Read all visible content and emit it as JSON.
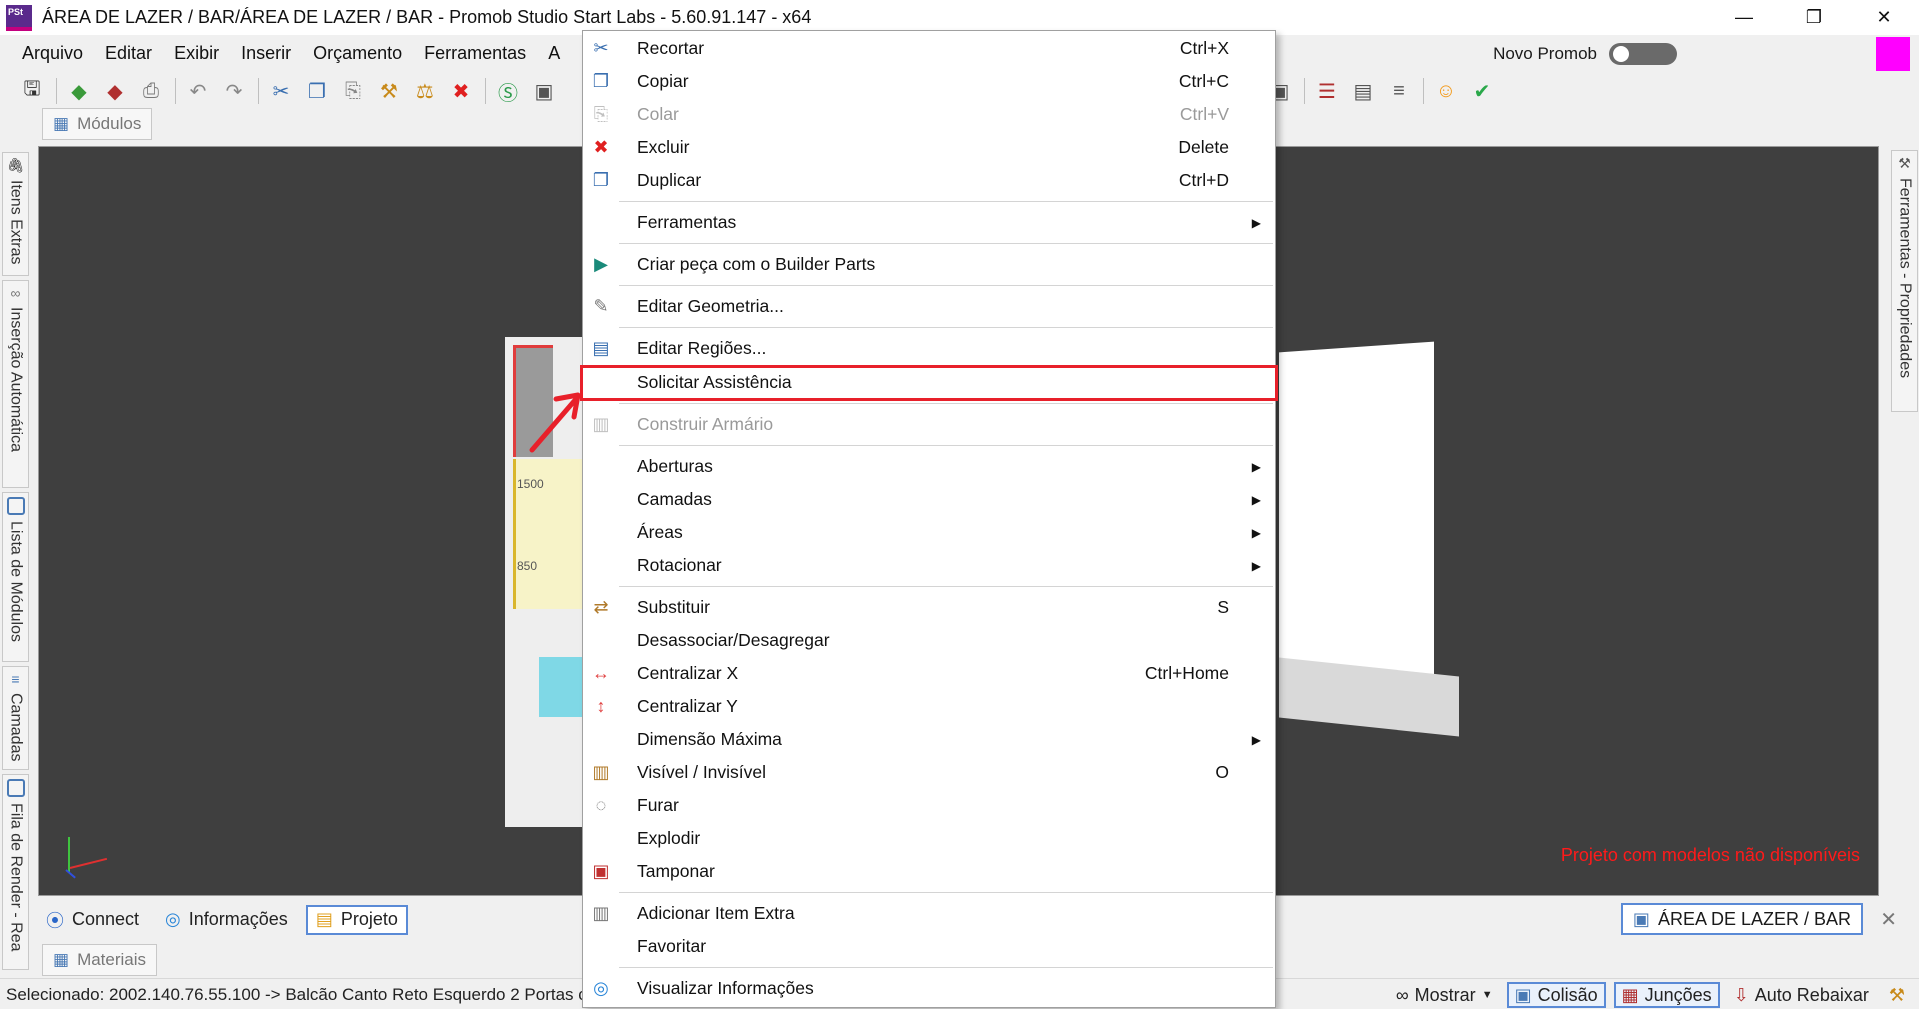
{
  "window": {
    "title": "ÁREA DE LAZER / BAR/ÁREA DE LAZER / BAR - Promob Studio Start Labs - 5.60.91.147 - x64",
    "logo_text": "PSt",
    "minimize": "—",
    "restore": "❐",
    "close": "✕"
  },
  "menubar": {
    "items": [
      "Arquivo",
      "Editar",
      "Exibir",
      "Inserir",
      "Orçamento",
      "Ferramentas",
      "A"
    ],
    "novo_promob": "Novo Promob"
  },
  "tabs": {
    "modulos": "Módulos",
    "materiais": "Materiais"
  },
  "left_panels": [
    "Itens Extras",
    "Inserção Automática",
    "Lista de Módulos",
    "Camadas",
    "Fila de Render - Rea"
  ],
  "right_panels": [
    "Ferramentas - Propriedades"
  ],
  "viewport": {
    "dim_top": "1500",
    "dim_bottom": "850",
    "warning": "Projeto com modelos não disponíveis"
  },
  "bottom_tabs": {
    "connect": "Connect",
    "informacoes": "Informações",
    "projeto": "Projeto",
    "document": "ÁREA DE LAZER / BAR",
    "close": "✕"
  },
  "statusbar": {
    "selected": "Selecionado: 2002.140.76.55.100 -> Balcão Canto Reto Esquerdo 2 Portas c",
    "mostrar": "Mostrar",
    "colisao": "Colisão",
    "juncoes": "Junções",
    "auto_rebaixar": "Auto Rebaixar"
  },
  "context_menu": {
    "items": [
      {
        "label": "Recortar",
        "shortcut": "Ctrl+X",
        "icon": "scissors-icon"
      },
      {
        "label": "Copiar",
        "shortcut": "Ctrl+C",
        "icon": "copy-icon"
      },
      {
        "label": "Colar",
        "shortcut": "Ctrl+V",
        "icon": "paste-icon",
        "disabled": true
      },
      {
        "label": "Excluir",
        "shortcut": "Delete",
        "icon": "delete-icon"
      },
      {
        "label": "Duplicar",
        "shortcut": "Ctrl+D",
        "icon": "duplicate-icon"
      },
      {
        "label": "Ferramentas",
        "submenu": true
      },
      {
        "label": "Criar peça com o Builder Parts",
        "icon": "builder-parts-icon"
      },
      {
        "label": "Editar Geometria...",
        "icon": "geometry-icon"
      },
      {
        "label": "Editar Regiões...",
        "icon": "regions-icon"
      },
      {
        "label": "Solicitar Assistência"
      },
      {
        "label": "Construir Armário",
        "icon": "cabinet-icon",
        "disabled": true
      },
      {
        "label": "Aberturas",
        "submenu": true
      },
      {
        "label": "Camadas",
        "submenu": true
      },
      {
        "label": "Áreas",
        "submenu": true
      },
      {
        "label": "Rotacionar",
        "submenu": true
      },
      {
        "label": "Substituir",
        "shortcut": "S",
        "icon": "replace-icon"
      },
      {
        "label": "Desassociar/Desagregar"
      },
      {
        "label": "Centralizar X",
        "shortcut": "Ctrl+Home",
        "icon": "center-x-icon"
      },
      {
        "label": "Centralizar Y",
        "icon": "center-y-icon"
      },
      {
        "label": "Dimensão Máxima",
        "submenu": true
      },
      {
        "label": "Visível / Invisível",
        "shortcut": "O",
        "icon": "visibility-icon"
      },
      {
        "label": "Furar",
        "icon": "drill-icon"
      },
      {
        "label": "Explodir"
      },
      {
        "label": "Tamponar",
        "icon": "cover-icon"
      },
      {
        "label": "Adicionar Item Extra",
        "icon": "extra-item-icon"
      },
      {
        "label": "Favoritar"
      },
      {
        "label": "Visualizar Informações",
        "icon": "globe-icon"
      }
    ],
    "arrow": "▶"
  },
  "colors": {
    "highlight": "#e8202a",
    "viewport_bg": "#3f3f3f",
    "warning": "#ff1a1a",
    "accent_blue": "#5a8ad6",
    "magenta": "#ff00ff"
  }
}
